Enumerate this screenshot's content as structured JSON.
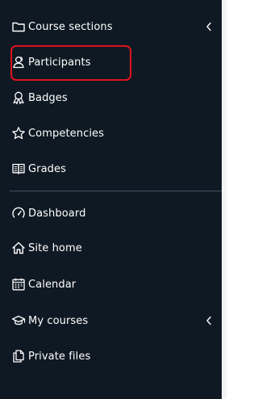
{
  "nav": {
    "section_items": [
      {
        "label": "Course sections",
        "icon": "folder-icon"
      },
      {
        "label": "Participants",
        "icon": "participants-icon"
      },
      {
        "label": "Badges",
        "icon": "badges-icon"
      },
      {
        "label": "Competencies",
        "icon": "star-icon"
      },
      {
        "label": "Grades",
        "icon": "gradebook-icon"
      }
    ],
    "site_items": [
      {
        "label": "Dashboard",
        "icon": "dashboard-gauge-icon"
      },
      {
        "label": "Site home",
        "icon": "home-icon"
      },
      {
        "label": "Calendar",
        "icon": "calendar-icon"
      },
      {
        "label": "My courses",
        "icon": "graduation-cap-icon"
      },
      {
        "label": "Private files",
        "icon": "files-icon"
      }
    ]
  },
  "colors": {
    "background": "#0f1923",
    "text": "#ffffff",
    "highlight_border": "#e0121c",
    "divider": "#3b5463"
  }
}
